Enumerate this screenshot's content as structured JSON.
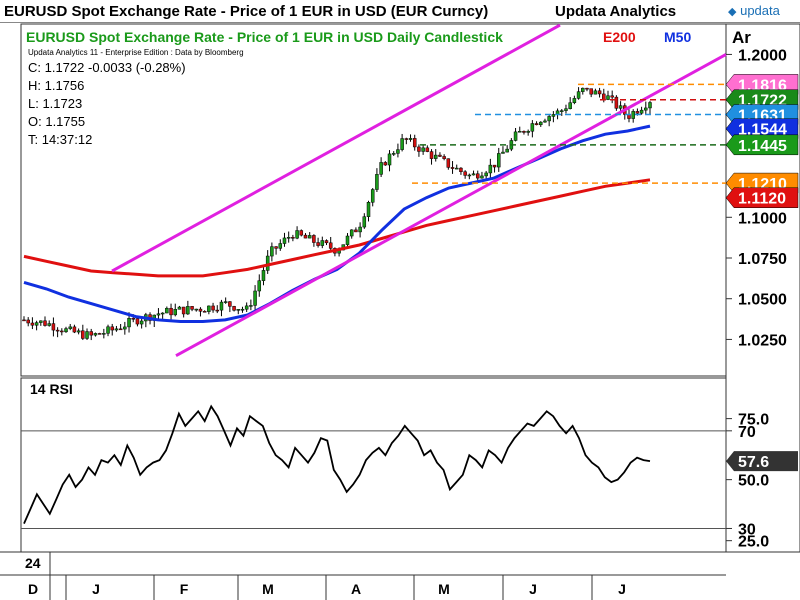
{
  "header": {
    "title": "EURUSD Spot Exchange Rate - Price of 1 EUR in USD (EUR Curncy)",
    "vendor": "Updata Analytics",
    "logo": "updata",
    "corner": "Ar"
  },
  "legend": {
    "subtitle": "EURUSD Spot Exchange Rate - Price of 1 EUR in USD Daily Candlestick",
    "e200": "E200",
    "m50": "M50",
    "credit": "Updata Analytics 11 - Enterprise Edition : Data by Bloomberg",
    "close": "C: 1.1722  -0.0033 (-0.28%)",
    "high": "H: 1.1756",
    "low": "L: 1.1723",
    "open": "O: 1.1755",
    "time": "T: 14:37:12"
  },
  "colors": {
    "e200": "#e01010",
    "m50": "#1030e0",
    "channel": "#e020e0",
    "subtitle": "#1a9a1a",
    "up": "#1a9a1a",
    "down": "#d01010"
  },
  "rsi": {
    "label": "14 RSI",
    "value_label": "57.6"
  },
  "bottom": {
    "year": "24",
    "months": [
      "D",
      "J",
      "F",
      "M",
      "A",
      "M",
      "J",
      "J"
    ]
  },
  "chart_data": [
    {
      "type": "line",
      "title": "EURUSD Spot Exchange Rate - Price of 1 EUR in USD Daily Candlestick",
      "x": [
        "D",
        "",
        "",
        "J",
        "",
        "",
        "",
        "F",
        "",
        "",
        "",
        "M",
        "",
        "",
        "",
        "A",
        "",
        "",
        "",
        "M",
        "",
        "",
        "",
        "J",
        "",
        "",
        "",
        "J",
        ""
      ],
      "ylim": [
        1.005,
        1.215
      ],
      "yticks": [
        1.025,
        1.05,
        1.075,
        1.1,
        1.125,
        1.15,
        1.175,
        1.2
      ],
      "ytick_labels": [
        "1.0250",
        "1.0500",
        "1.0750",
        "1.1000",
        "",
        "",
        "",
        "1.2000"
      ],
      "series": [
        {
          "name": "Price",
          "values": [
            1.037,
            1.035,
            1.03,
            1.027,
            1.031,
            1.037,
            1.041,
            1.043,
            1.044,
            1.047,
            1.043,
            1.078,
            1.09,
            1.085,
            1.08,
            1.095,
            1.132,
            1.148,
            1.14,
            1.132,
            1.125,
            1.132,
            1.15,
            1.16,
            1.165,
            1.178,
            1.175,
            1.162,
            1.172
          ]
        },
        {
          "name": "E200",
          "values": [
            1.076,
            1.073,
            1.07,
            1.067,
            1.066,
            1.065,
            1.064,
            1.064,
            1.064,
            1.066,
            1.068,
            1.071,
            1.074,
            1.077,
            1.08,
            1.083,
            1.087,
            1.091,
            1.095,
            1.098,
            1.101,
            1.104,
            1.107,
            1.11,
            1.113,
            1.116,
            1.119,
            1.121,
            1.123
          ]
        },
        {
          "name": "M50",
          "values": [
            1.06,
            1.056,
            1.051,
            1.047,
            1.043,
            1.039,
            1.037,
            1.036,
            1.036,
            1.037,
            1.04,
            1.047,
            1.055,
            1.062,
            1.068,
            1.078,
            1.092,
            1.105,
            1.112,
            1.118,
            1.121,
            1.124,
            1.13,
            1.136,
            1.142,
            1.147,
            1.151,
            1.153,
            1.156
          ]
        }
      ],
      "tags": [
        {
          "value": 1.1816,
          "label": "1.1816",
          "color": "#ff6fd0",
          "line": "#ff8c00"
        },
        {
          "value": 1.1722,
          "label": "1.1722",
          "color": "#1a8a1a",
          "line": "#d01010"
        },
        {
          "value": 1.1631,
          "label": "1.1631",
          "color": "#2090e0",
          "line": "#2090e0"
        },
        {
          "value": 1.1544,
          "label": "1.1544",
          "color": "#1030e0",
          "line": ""
        },
        {
          "value": 1.1445,
          "label": "1.1445",
          "color": "#1a9a1a",
          "line": "#1a6a1a"
        },
        {
          "value": 1.121,
          "label": "1.1210",
          "color": "#ff8c00",
          "line": "#ff8c00"
        },
        {
          "value": 1.112,
          "label": "1.1120",
          "color": "#e01010",
          "line": ""
        }
      ]
    },
    {
      "type": "line",
      "title": "14 RSI",
      "ylim": [
        22,
        90
      ],
      "yticks": [
        75,
        70,
        50,
        30,
        25
      ],
      "ytick_labels": [
        "75.0",
        "70",
        "50.0",
        "30",
        "25.0"
      ],
      "hlines": [
        70,
        30
      ],
      "series": [
        {
          "name": "14 RSI",
          "values": [
            32,
            38,
            44,
            40,
            36,
            42,
            48,
            52,
            47,
            50,
            55,
            52,
            58,
            57,
            60,
            56,
            64,
            59,
            52,
            55,
            57,
            58,
            62,
            69,
            77,
            72,
            75,
            78,
            74,
            80,
            76,
            70,
            64,
            71,
            68,
            76,
            74,
            72,
            65,
            60,
            58,
            55,
            63,
            60,
            57,
            61,
            67,
            66,
            54,
            50,
            45,
            48,
            52,
            58,
            61,
            63,
            60,
            65,
            68,
            72,
            69,
            66,
            60,
            62,
            57,
            54,
            46,
            49,
            52,
            60,
            58,
            55,
            62,
            60,
            57,
            63,
            67,
            70,
            73,
            72,
            75,
            78,
            76,
            72,
            69,
            72,
            67,
            60,
            57,
            55,
            51,
            49,
            50,
            53,
            57,
            59,
            58,
            57.6
          ]
        }
      ],
      "last": 57.6
    }
  ]
}
